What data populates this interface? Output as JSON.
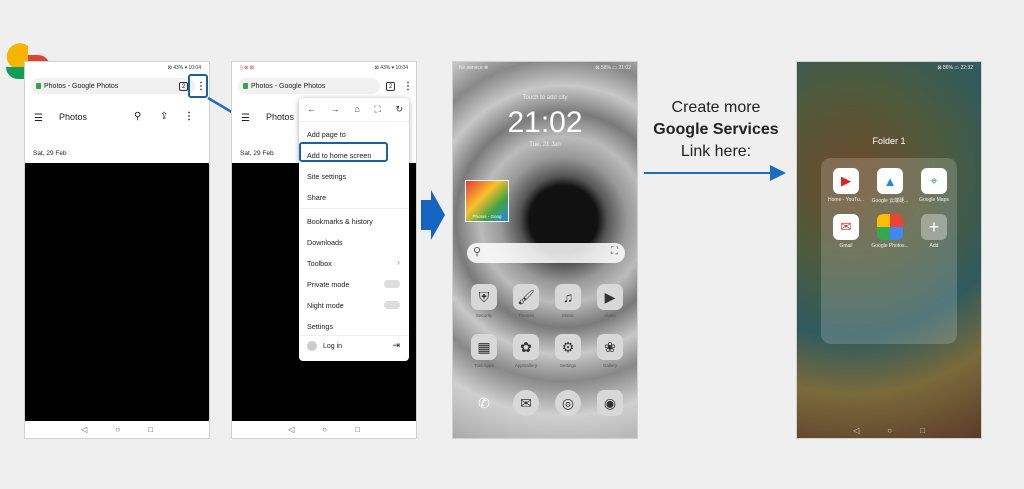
{
  "status": {
    "right": "⊠ 43% ▾ 10:04",
    "left_icons": "▯ ⊗ ⊠"
  },
  "browser": {
    "title": "Photos - Google Photos",
    "tab_count": "2",
    "menu_icon": "⋮"
  },
  "photos_app": {
    "title": "Photos",
    "date": "Sat, 29 Feb"
  },
  "menu": {
    "items": [
      "Add page to",
      "Add to home screen",
      "Site settings",
      "Share",
      "Bookmarks & history",
      "Downloads",
      "Toolbox",
      "Private mode",
      "Night mode",
      "Settings"
    ],
    "login": "Log in",
    "toolbox_arrow": "›"
  },
  "home_screen": {
    "status_left": "No service ⊕",
    "status_right": "⊠ 58% ▭ 21:02",
    "lock_hint": "Touch to add city",
    "time": "21:02",
    "date": "Tue, 21 Jan",
    "shortcut_label": "Photos - Goog",
    "apps_row1": [
      "Security",
      "Themes",
      "Music",
      "Video"
    ],
    "apps_row2": [
      "Tool Apps",
      "AppGallery",
      "Settings",
      "Gallery"
    ]
  },
  "callout": {
    "line1": "Create more",
    "line2": "Google Services",
    "line3": "Link here:"
  },
  "folder_screen": {
    "status_right": "⊠ 86% ▭ 22:32",
    "folder_title": "Folder 1",
    "apps": [
      "Home - YouTu...",
      "Google 云端硬...",
      "Google Maps",
      "Gmail",
      "Google Photos...",
      "Add"
    ]
  },
  "nav": {
    "back": "◁",
    "home": "○",
    "recent": "□"
  },
  "colors": {
    "accent": "#1a5fa8",
    "arrow": "#1e6cc1",
    "big_arrow": "#1565c0"
  }
}
